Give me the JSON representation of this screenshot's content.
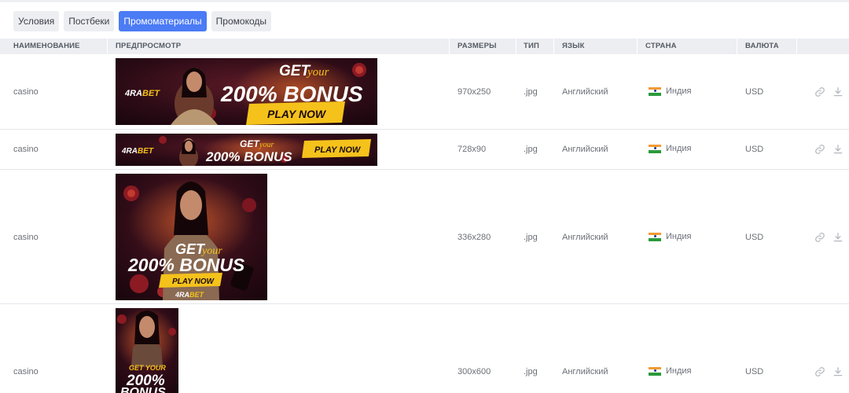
{
  "tabs": [
    {
      "label": "Условия",
      "active": false
    },
    {
      "label": "Постбеки",
      "active": false
    },
    {
      "label": "Промоматериалы",
      "active": true
    },
    {
      "label": "Промокоды",
      "active": false
    }
  ],
  "table": {
    "headers": {
      "name": "НАИМЕНОВАНИЕ",
      "preview": "ПРЕДПРОСМОТР",
      "sizes": "РАЗМЕРЫ",
      "type": "ТИП",
      "language": "ЯЗЫК",
      "country": "СТРАНА",
      "currency": "ВАЛЮТА"
    },
    "rows": [
      {
        "name": "casino",
        "size": "970x250",
        "type": ".jpg",
        "language": "Английский",
        "country": "Индия",
        "currency": "USD"
      },
      {
        "name": "casino",
        "size": "728x90",
        "type": ".jpg",
        "language": "Английский",
        "country": "Индия",
        "currency": "USD"
      },
      {
        "name": "casino",
        "size": "336x280",
        "type": ".jpg",
        "language": "Английский",
        "country": "Индия",
        "currency": "USD"
      },
      {
        "name": "casino",
        "size": "300x600",
        "type": ".jpg",
        "language": "Английский",
        "country": "Индия",
        "currency": "USD"
      }
    ]
  },
  "banners": {
    "brand_a": "4RA",
    "brand_b": "BET",
    "get": "GET",
    "your": "your",
    "your_caps": "GET YOUR",
    "bonus": "200% BONUS",
    "bonus_pct": "200%",
    "bonus_word": "BONUS",
    "cta": "PLAY NOW"
  },
  "icons": {
    "link": "link-icon",
    "download": "download-icon",
    "flag": "india-flag-icon"
  },
  "colors": {
    "accent": "#4b7bf5",
    "banner_bg": "#2a0a14",
    "banner_gold": "#f5c21b",
    "icon": "#b4b8bf"
  }
}
